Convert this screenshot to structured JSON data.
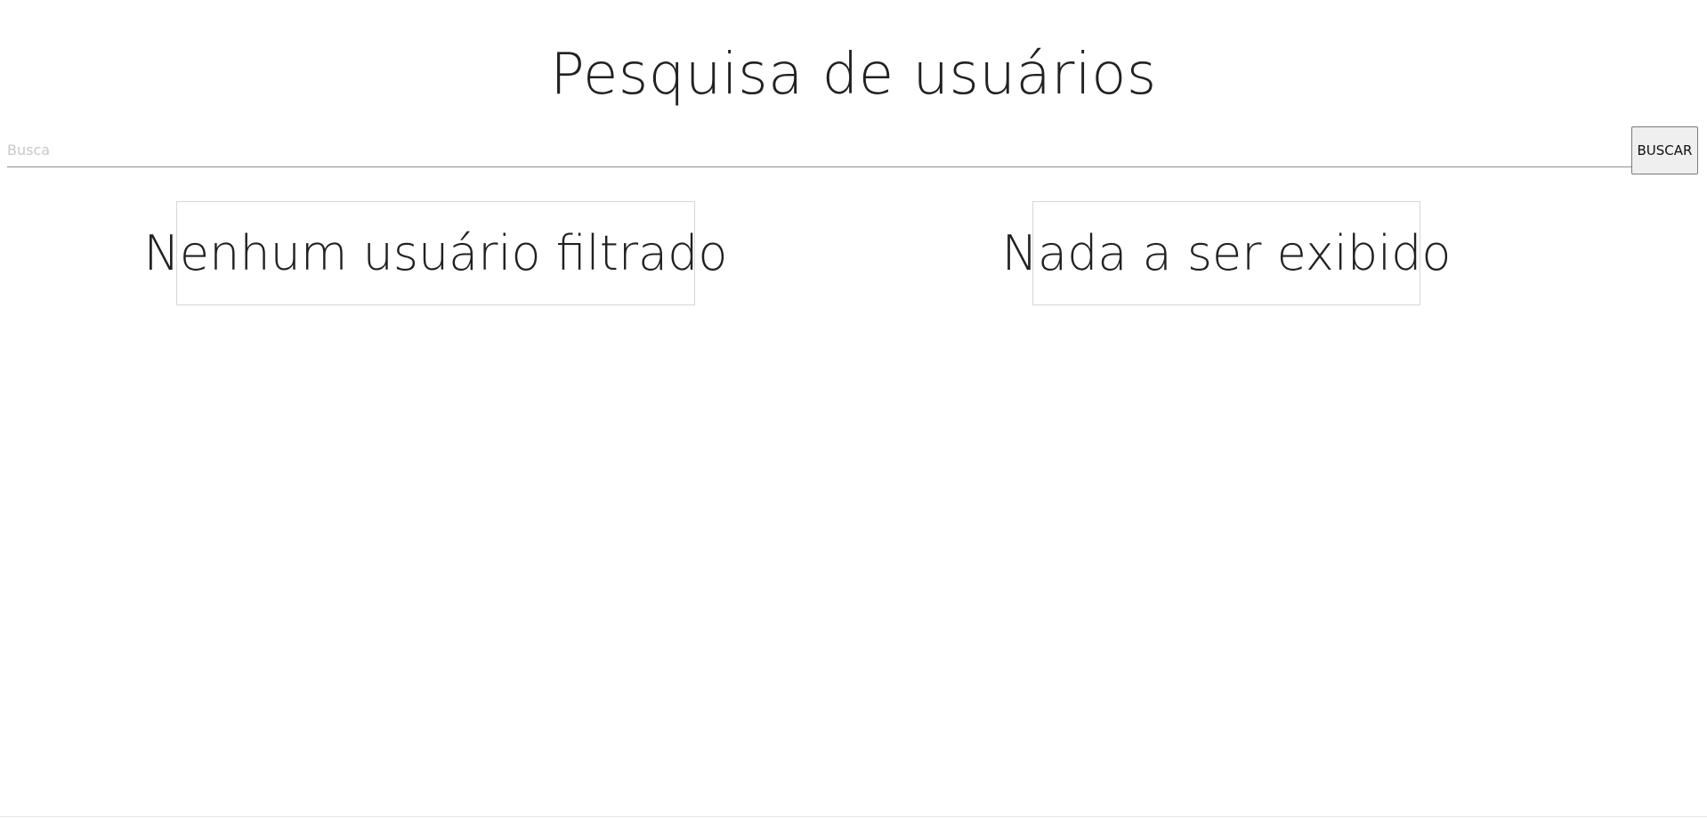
{
  "header": {
    "title": "Pesquisa de usuários"
  },
  "search": {
    "placeholder": "Busca",
    "value": "",
    "button_label": "BUSCAR"
  },
  "panels": {
    "filtered_users": {
      "message": "Nenhum usuário filtrado"
    },
    "display": {
      "message": "Nada a ser exibido"
    }
  },
  "colors": {
    "text": "#212121",
    "placeholder": "#c8c8c8",
    "underline": "#8d8d8d",
    "panel_border": "#d6d6d6",
    "button_background": "#efefef",
    "button_border": "#7a7a7a"
  }
}
